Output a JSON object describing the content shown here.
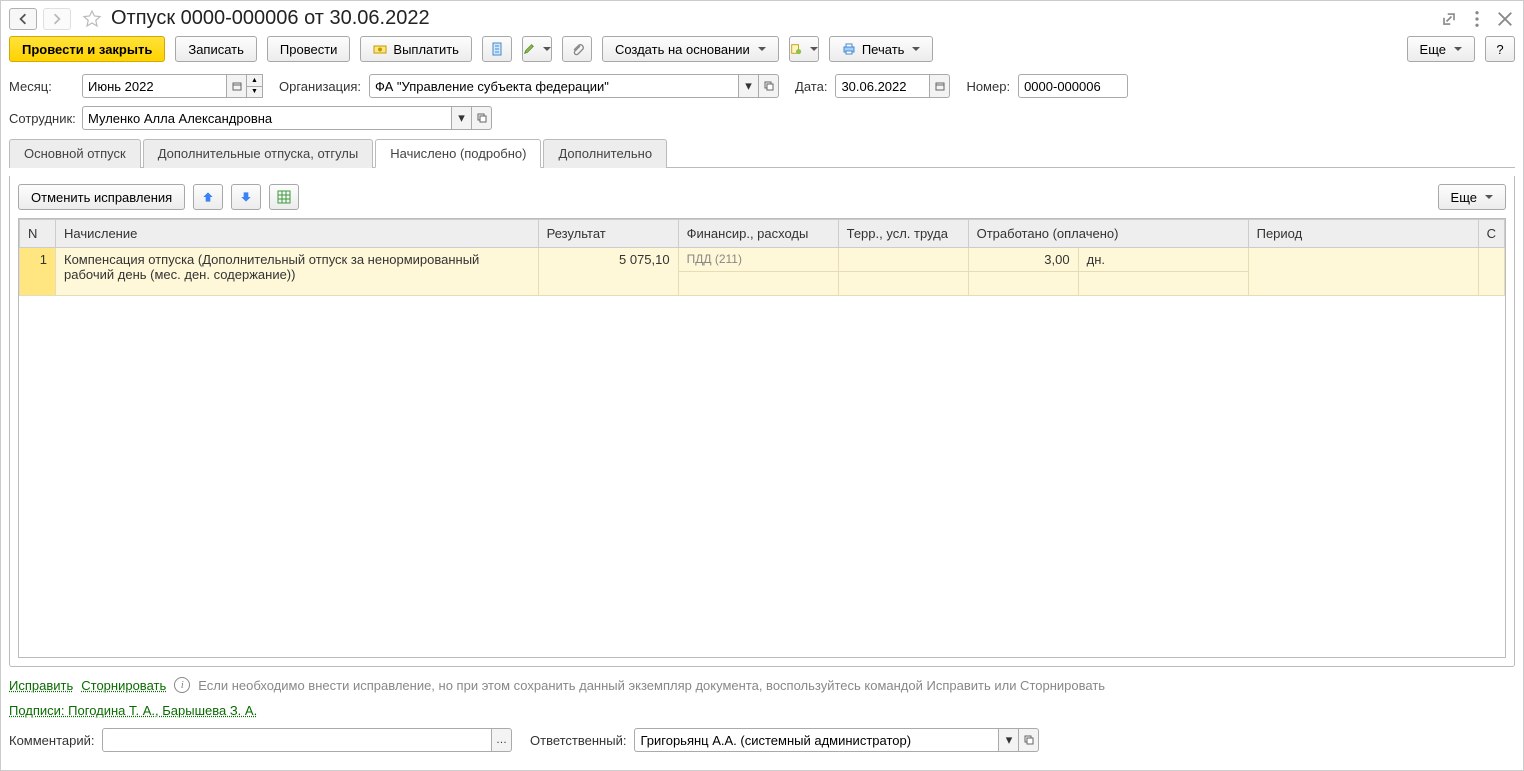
{
  "title": "Отпуск 0000-000006 от 30.06.2022",
  "toolbar": {
    "post_close": "Провести и закрыть",
    "save": "Записать",
    "post": "Провести",
    "pay": "Выплатить",
    "create_based": "Создать на основании",
    "print": "Печать",
    "more": "Еще",
    "help": "?"
  },
  "form": {
    "month_label": "Месяц:",
    "month_value": "Июнь 2022",
    "org_label": "Организация:",
    "org_value": "ФА \"Управление субъекта федерации\"",
    "date_label": "Дата:",
    "date_value": "30.06.2022",
    "number_label": "Номер:",
    "number_value": "0000-000006",
    "employee_label": "Сотрудник:",
    "employee_value": "Муленко Алла Александровна"
  },
  "tabs": {
    "t1": "Основной отпуск",
    "t2": "Дополнительные отпуска, отгулы",
    "t3": "Начислено (подробно)",
    "t4": "Дополнительно"
  },
  "tab_toolbar": {
    "cancel_fix": "Отменить исправления",
    "more": "Еще"
  },
  "grid": {
    "headers": {
      "n": "N",
      "accrual": "Начисление",
      "result": "Результат",
      "financing": "Финансир., расходы",
      "terr": "Терр., усл. труда",
      "worked": "Отработано (оплачено)",
      "period": "Период",
      "s": "С"
    },
    "rows": [
      {
        "n": "1",
        "accrual": "Компенсация отпуска (Дополнительный отпуск за ненормированный рабочий день (мес. ден. содержание))",
        "result": "5 075,10",
        "financing": "ПДД (211)",
        "worked": "3,00",
        "unit": "дн."
      }
    ]
  },
  "footer": {
    "fix": "Исправить",
    "reverse": "Сторнировать",
    "hint": "Если необходимо внести исправление, но при этом сохранить данный экземпляр документа, воспользуйтесь командой Исправить или Сторнировать",
    "signatures": "Подписи: Погодина Т. А., Барышева З. А.",
    "comment_label": "Комментарий:",
    "comment_value": "",
    "responsible_label": "Ответственный:",
    "responsible_value": "Григорьянц А.А. (системный администратор)"
  }
}
